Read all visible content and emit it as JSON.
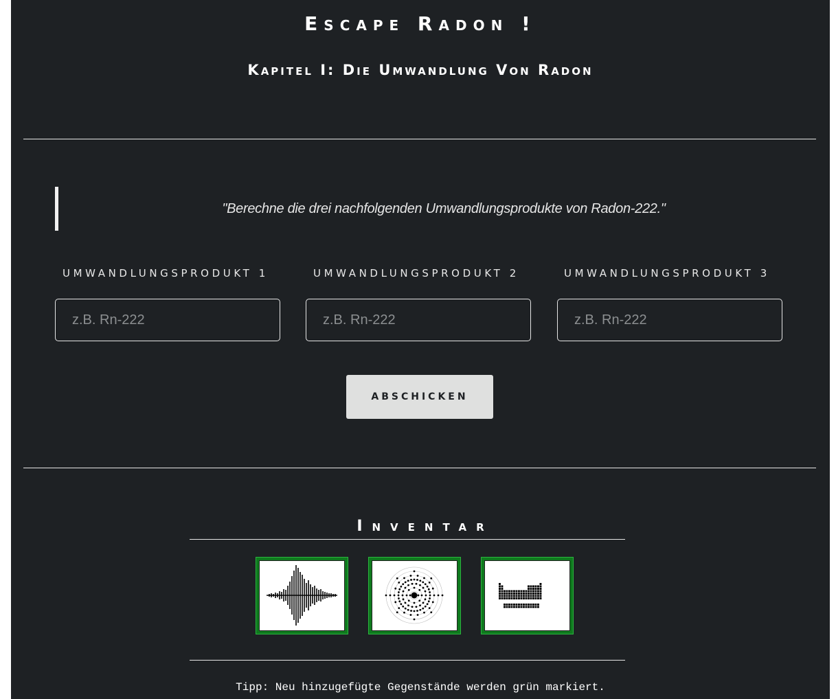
{
  "header": {
    "title": "Escape Radon !",
    "subtitle": "Kapitel I: Die Umwandlung Von Radon"
  },
  "task": {
    "quote": "\"Berechne die drei nachfolgenden Umwandlungsprodukte von Radon-222.\""
  },
  "form": {
    "fields": [
      {
        "label": "UMWANDLUNGSPRODUKT 1",
        "placeholder": "z.B. Rn-222",
        "value": ""
      },
      {
        "label": "UMWANDLUNGSPRODUKT 2",
        "placeholder": "z.B. Rn-222",
        "value": ""
      },
      {
        "label": "UMWANDLUNGSPRODUKT 3",
        "placeholder": "z.B. Rn-222",
        "value": ""
      }
    ],
    "submit_label": "ABSCHICKEN"
  },
  "inventory": {
    "title": "Inventar",
    "items": [
      {
        "icon": "waveform-icon",
        "highlight": "green"
      },
      {
        "icon": "atom-shell-icon",
        "highlight": "green"
      },
      {
        "icon": "periodic-table-icon",
        "highlight": "green"
      }
    ],
    "tip": "Tipp: Neu hinzugefügte Gegenstände werden grün markiert."
  },
  "colors": {
    "background": "#1e2124",
    "text": "#ffffff",
    "button_bg": "#dfe0df",
    "new_item_border": "#0f7a1e"
  }
}
